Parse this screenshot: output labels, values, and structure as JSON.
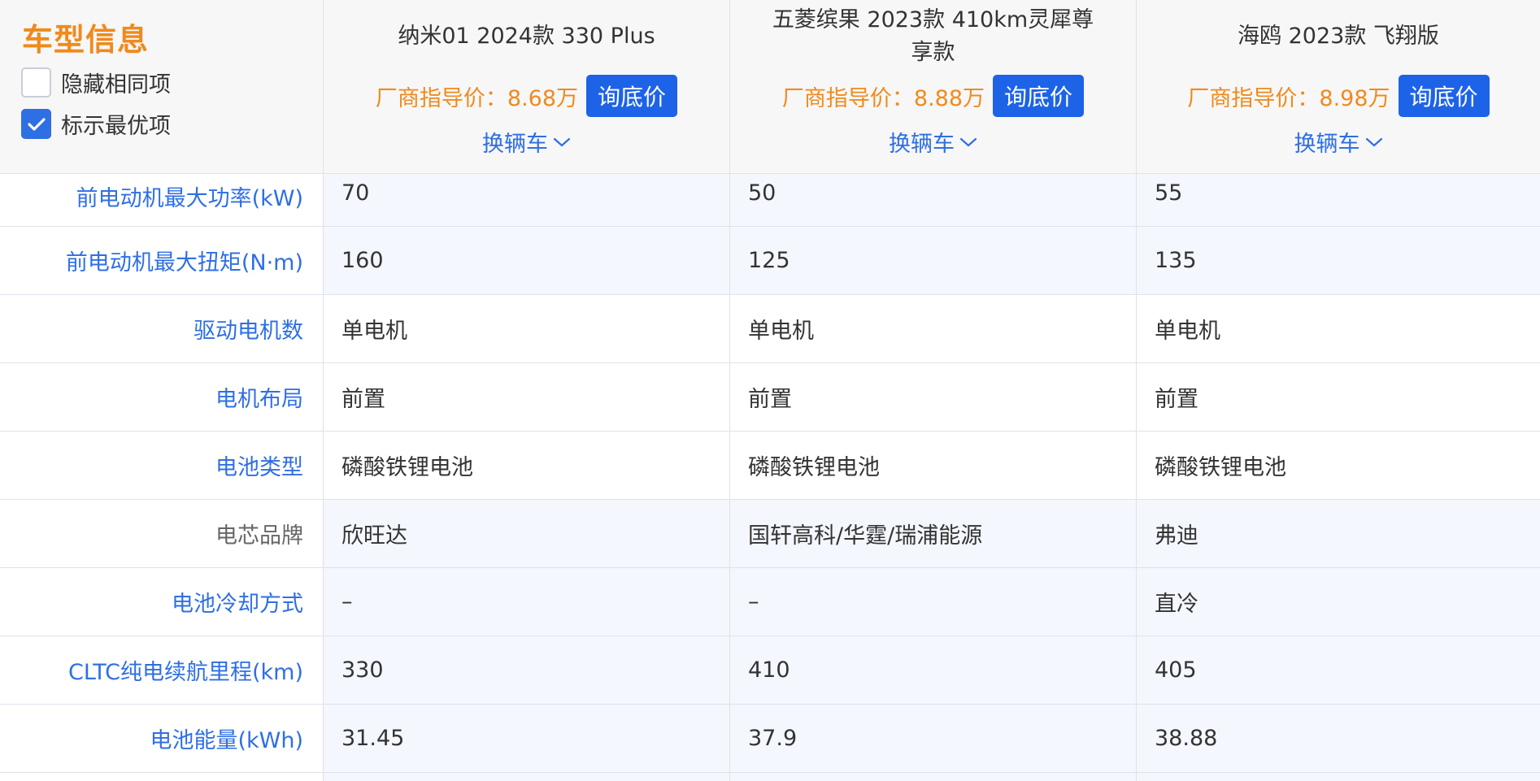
{
  "header": {
    "title": "车型信息",
    "options": [
      {
        "label": "隐藏相同项",
        "checked": false
      },
      {
        "label": "标示最优项",
        "checked": true
      }
    ],
    "price_label": "厂商指导价：",
    "ask_label": "询底价",
    "switch_label": "换辆车",
    "cars": [
      {
        "name": "纳米01 2024款 330 Plus",
        "price": "8.68万"
      },
      {
        "name": "五菱缤果 2023款 410km灵犀尊享款",
        "price": "8.88万"
      },
      {
        "name": "海鸥 2023款 飞翔版",
        "price": "8.98万"
      }
    ]
  },
  "rows": [
    {
      "label": "前电动机最大功率(kW)",
      "values": [
        "70",
        "50",
        "55"
      ]
    },
    {
      "label": "前电动机最大扭矩(N·m)",
      "values": [
        "160",
        "125",
        "135"
      ]
    },
    {
      "label": "驱动电机数",
      "values": [
        "单电机",
        "单电机",
        "单电机"
      ]
    },
    {
      "label": "电机布局",
      "values": [
        "前置",
        "前置",
        "前置"
      ]
    },
    {
      "label": "电池类型",
      "values": [
        "磷酸铁锂电池",
        "磷酸铁锂电池",
        "磷酸铁锂电池"
      ]
    },
    {
      "label": "电芯品牌",
      "values": [
        "欣旺达",
        "国轩高科/华霆/瑞浦能源",
        "弗迪"
      ]
    },
    {
      "label": "电池冷却方式",
      "values": [
        "–",
        "–",
        "直冷"
      ]
    },
    {
      "label": "CLTC纯电续航里程(km)",
      "values": [
        "330",
        "410",
        "405"
      ]
    },
    {
      "label": "电池能量(kWh)",
      "values": [
        "31.45",
        "37.9",
        "38.88"
      ]
    }
  ],
  "colors": {
    "accent_orange": "#f08a1c",
    "link_blue": "#2f6fe4",
    "button_blue": "#1d63e8",
    "row_alt_bg": "#f4f7fd"
  },
  "icons": [
    "check-icon",
    "chevron-down-icon"
  ]
}
